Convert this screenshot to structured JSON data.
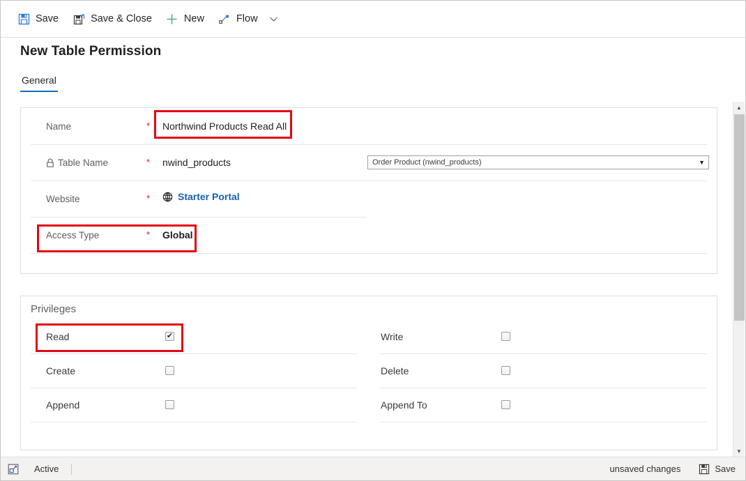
{
  "commandbar": {
    "items": [
      {
        "label": "Save",
        "icon": "save-icon"
      },
      {
        "label": "Save & Close",
        "icon": "save-and-close-icon"
      },
      {
        "label": "New",
        "icon": "plus-icon"
      },
      {
        "label": "Flow",
        "icon": "flow-icon"
      }
    ],
    "overflow_icon": "chevron-down-icon"
  },
  "header": {
    "title": "New Table Permission",
    "tabs": [
      {
        "label": "General",
        "active": true
      }
    ]
  },
  "general": {
    "rows": [
      {
        "label": "Name",
        "required": "*",
        "value": "Northwind Products Read All",
        "highlighted": true
      },
      {
        "label": "Table Name",
        "required": "*",
        "value": "nwind_products",
        "locked": true,
        "lookup": {
          "value": "Order Product (nwind_products)",
          "caret": "▼"
        }
      },
      {
        "label": "Website",
        "required": "*",
        "value": "Starter Portal",
        "is_link": true,
        "icon": "globe-icon"
      },
      {
        "label": "Access Type",
        "required": "*",
        "value": "Global",
        "highlighted": true
      }
    ]
  },
  "privileges": {
    "heading": "Privileges",
    "left": [
      {
        "label": "Read",
        "checked": true,
        "check_glyph": "✔",
        "highlighted": true
      },
      {
        "label": "Create",
        "checked": false,
        "check_glyph": ""
      },
      {
        "label": "Append",
        "checked": false,
        "check_glyph": ""
      }
    ],
    "right": [
      {
        "label": "Write",
        "checked": false,
        "check_glyph": ""
      },
      {
        "label": "Delete",
        "checked": false,
        "check_glyph": ""
      },
      {
        "label": "Append To",
        "checked": false,
        "check_glyph": ""
      }
    ]
  },
  "scrollbar": {
    "up_glyph": "▲",
    "down_glyph": "▼"
  },
  "statusbar": {
    "icon": "popout-icon",
    "state": "Active",
    "unsaved": "unsaved changes",
    "save_label": "Save",
    "save_icon": "save-icon"
  },
  "colors": {
    "accent": "#0f6cbd",
    "link": "#1a5fb4",
    "required": "#e81123",
    "highlight": "#e30613"
  }
}
